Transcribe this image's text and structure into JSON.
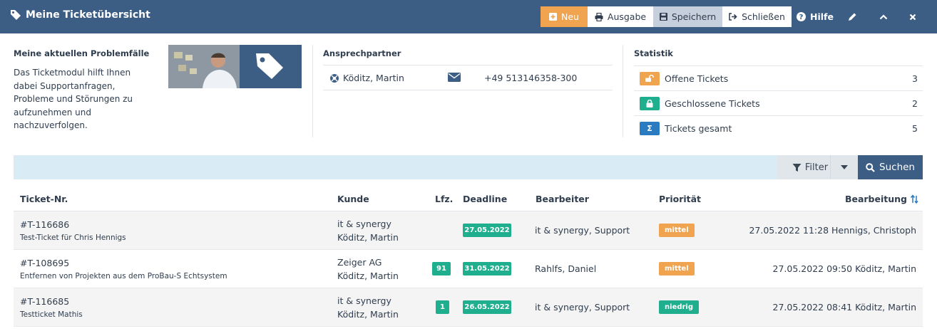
{
  "header": {
    "title": "Meine Ticketübersicht",
    "buttons": {
      "new": "Neu",
      "output": "Ausgabe",
      "save": "Speichern",
      "close": "Schließen",
      "help": "Hilfe"
    }
  },
  "intro": {
    "heading": "Meine aktuellen Problemfälle",
    "text": "Das Ticketmodul hilft Ihnen dabei Supportanfragen, Probleme und Störungen zu aufzunehmen und nachzuverfolgen."
  },
  "contact": {
    "heading": "Ansprechpartner",
    "name": "Köditz, Martin",
    "phone": "+49 513146358-300"
  },
  "stats": {
    "heading": "Statistik",
    "items": [
      {
        "label": "Offene Tickets",
        "value": "3",
        "color": "#f0a450",
        "icon": "unlock-icon"
      },
      {
        "label": "Geschlossene Tickets",
        "value": "2",
        "color": "#1fae8e",
        "icon": "lock-icon"
      },
      {
        "label": "Tickets gesamt",
        "value": "5",
        "color": "#2a7bbf",
        "icon": "sigma-icon"
      }
    ]
  },
  "filterbar": {
    "filter_label": "Filter",
    "search_label": "Suchen"
  },
  "table": {
    "columns": [
      "Ticket-Nr.",
      "Kunde",
      "Lfz.",
      "Deadline",
      "Bearbeiter",
      "Priorität",
      "Bearbeitung"
    ],
    "rows": [
      {
        "number": "#T-116686",
        "subject": "Test-Ticket für Chris Hennigs",
        "customer": "it & synergy",
        "contact": "Köditz, Martin",
        "lfz": "",
        "deadline": "27.05.2022",
        "editor": "it & synergy, Support",
        "priority": "mittel",
        "last_edit": "27.05.2022 11:28 Hennigs, Christoph"
      },
      {
        "number": "#T-108695",
        "subject": "Entfernen von Projekten aus dem ProBau-S Echtsystem",
        "customer": "Zeiger AG",
        "contact": "Köditz, Martin",
        "lfz": "91",
        "deadline": "31.05.2022",
        "editor": "Rahlfs, Daniel",
        "priority": "mittel",
        "last_edit": "27.05.2022 09:50 Köditz, Martin"
      },
      {
        "number": "#T-116685",
        "subject": "Testticket Mathis",
        "customer": "it & synergy",
        "contact": "Köditz, Martin",
        "lfz": "1",
        "deadline": "26.05.2022",
        "editor": "it & synergy, Support",
        "priority": "niedrig",
        "last_edit": "27.05.2022 08:41 Köditz, Martin"
      }
    ]
  },
  "colors": {
    "header": "#3d5e84",
    "accent_orange": "#f0a450",
    "accent_green": "#1fae8e",
    "accent_blue": "#2a7bbf"
  }
}
